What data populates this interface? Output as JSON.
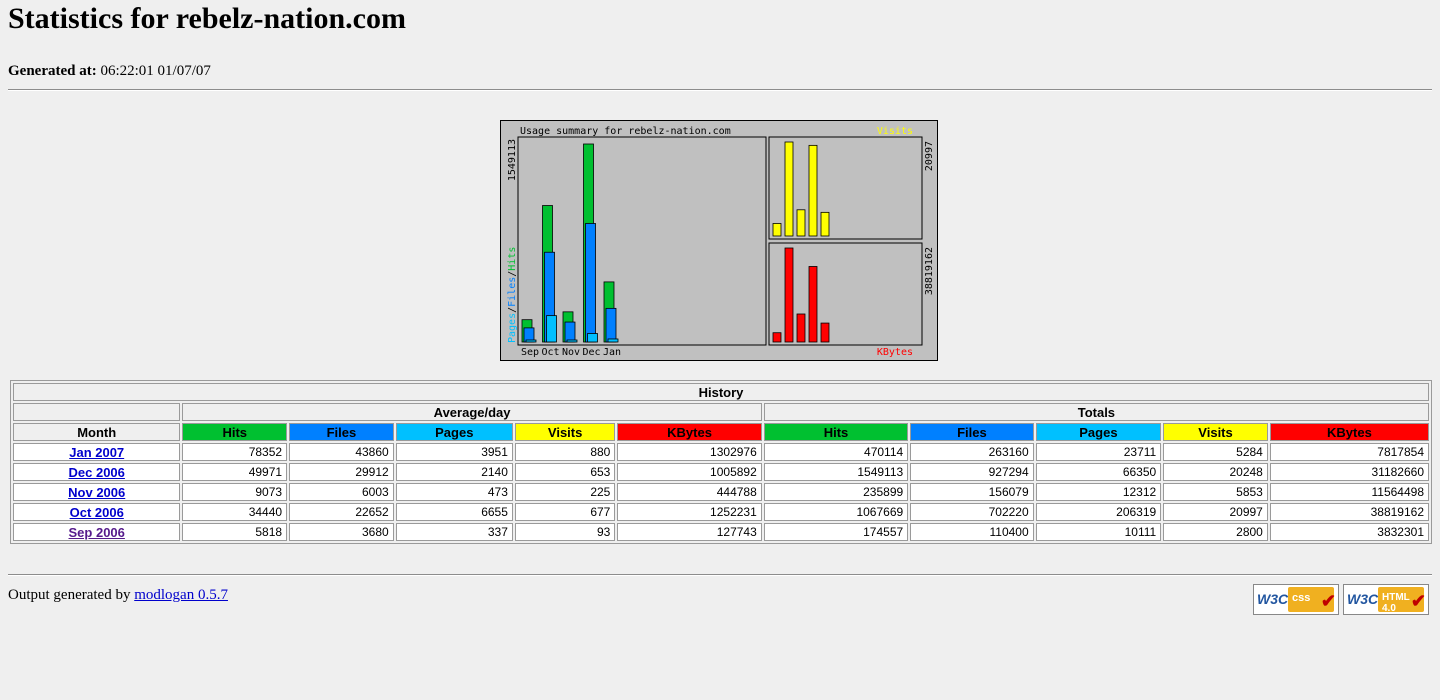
{
  "page": {
    "title": "Statistics for rebelz-nation.com",
    "generated_label": "Generated at:",
    "generated_value": "06:22:01 01/07/07"
  },
  "chart_data": {
    "type": "bar",
    "title": "Usage summary for rebelz-nation.com",
    "categories": [
      "Sep",
      "Oct",
      "Nov",
      "Dec",
      "Jan"
    ],
    "left_panel": {
      "ylabel": "Pages/Files/Hits",
      "ylabel_parts": [
        "Pages",
        "/",
        "Files",
        "/",
        "Hits"
      ],
      "ymax_label": "1549113",
      "ymax": 1549113,
      "series": [
        {
          "name": "Hits",
          "values": [
            174557,
            1067669,
            235899,
            1549113,
            470114
          ]
        },
        {
          "name": "Files",
          "values": [
            110400,
            702220,
            156079,
            927294,
            263160
          ]
        },
        {
          "name": "Pages",
          "values": [
            10111,
            206319,
            12312,
            66350,
            23711
          ]
        }
      ]
    },
    "visits_panel": {
      "label": "Visits",
      "ymax_label": "20997",
      "ymax": 20997,
      "series": [
        {
          "name": "Visits",
          "values": [
            2800,
            20997,
            5853,
            20248,
            5284
          ]
        }
      ]
    },
    "kbytes_panel": {
      "label": "KBytes",
      "ymax_label": "38819162",
      "ymax": 38819162,
      "series": [
        {
          "name": "KBytes",
          "values": [
            3832301,
            38819162,
            11564498,
            31182660,
            7817854
          ]
        }
      ]
    },
    "colors": {
      "hits": "#00c030",
      "files": "#0080ff",
      "pages": "#00c0ff",
      "visits": "#ffff00",
      "kbytes": "#ff0000",
      "background": "#c0c0c0"
    }
  },
  "table": {
    "caption": "History",
    "group_avg": "Average/day",
    "group_totals": "Totals",
    "month_header": "Month",
    "columns": [
      "Hits",
      "Files",
      "Pages",
      "Visits",
      "KBytes"
    ],
    "rows": [
      {
        "month": "Jan 2007",
        "avg": [
          "78352",
          "43860",
          "3951",
          "880",
          "1302976"
        ],
        "tot": [
          "470114",
          "263160",
          "23711",
          "5284",
          "7817854"
        ]
      },
      {
        "month": "Dec 2006",
        "avg": [
          "49971",
          "29912",
          "2140",
          "653",
          "1005892"
        ],
        "tot": [
          "1549113",
          "927294",
          "66350",
          "20248",
          "31182660"
        ]
      },
      {
        "month": "Nov 2006",
        "avg": [
          "9073",
          "6003",
          "473",
          "225",
          "444788"
        ],
        "tot": [
          "235899",
          "156079",
          "12312",
          "5853",
          "11564498"
        ]
      },
      {
        "month": "Oct 2006",
        "avg": [
          "34440",
          "22652",
          "6655",
          "677",
          "1252231"
        ],
        "tot": [
          "1067669",
          "702220",
          "206319",
          "20997",
          "38819162"
        ]
      },
      {
        "month": "Sep 2006",
        "avg": [
          "5818",
          "3680",
          "337",
          "93",
          "127743"
        ],
        "tot": [
          "174557",
          "110400",
          "10111",
          "2800",
          "3832301"
        ]
      }
    ]
  },
  "footer": {
    "text": "Output generated by",
    "link": "modlogan 0.5.7",
    "badge_css": {
      "w3c": "W3C",
      "label": "css"
    },
    "badge_html": {
      "w3c": "W3C",
      "label": "HTML 4.0"
    }
  }
}
